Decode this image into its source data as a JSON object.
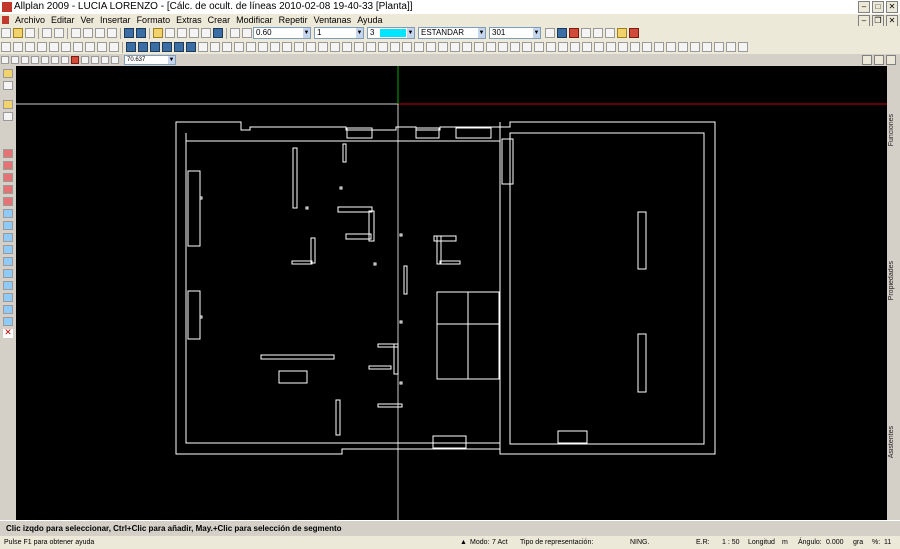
{
  "window": {
    "title": "Allplan 2009 - LUCIA LORENZO - [Cálc. de ocult. de líneas 2010-02-08 19-40-33 [Planta]]"
  },
  "menu": [
    "Archivo",
    "Editar",
    "Ver",
    "Insertar",
    "Formato",
    "Extras",
    "Crear",
    "Modificar",
    "Repetir",
    "Ventanas",
    "Ayuda"
  ],
  "toolbar": {
    "pen_value": "0.60",
    "line_value": "1",
    "color_value": "3",
    "color_swatch": "#00e5ff",
    "layer_value": "ESTANDAR",
    "pattern_value": "301"
  },
  "toolbar3": {
    "zoom_value": "70.637"
  },
  "right_panel": {
    "functions_label": "Funciones",
    "properties_label": "Propiedades",
    "assistants_label": "Asistentes"
  },
  "prompt": {
    "text": "Clic izqdo para seleccionar, Ctrl+Clic para añadir, May.+Clic para selección de segmento"
  },
  "status": {
    "help": "Pulse F1 para obtener ayuda",
    "mode_label": "Modo:",
    "mode_value": "7 Act",
    "rep_label": "Tipo de representación:",
    "rep_value": "NING.",
    "scale_label": "E.R:",
    "scale_value": "1 : 50",
    "length_label": "Longitud",
    "length_unit": "m",
    "angle_label": "Ángulo:",
    "angle_value": "0.000",
    "angle_unit": "gra",
    "percent_label": "%:",
    "percent_value": "11"
  },
  "colors": {
    "canvas_bg": "#000000",
    "drawing_line": "#ffffff",
    "crosshair_red": "#cc0000",
    "crosshair_green": "#00aa00"
  }
}
